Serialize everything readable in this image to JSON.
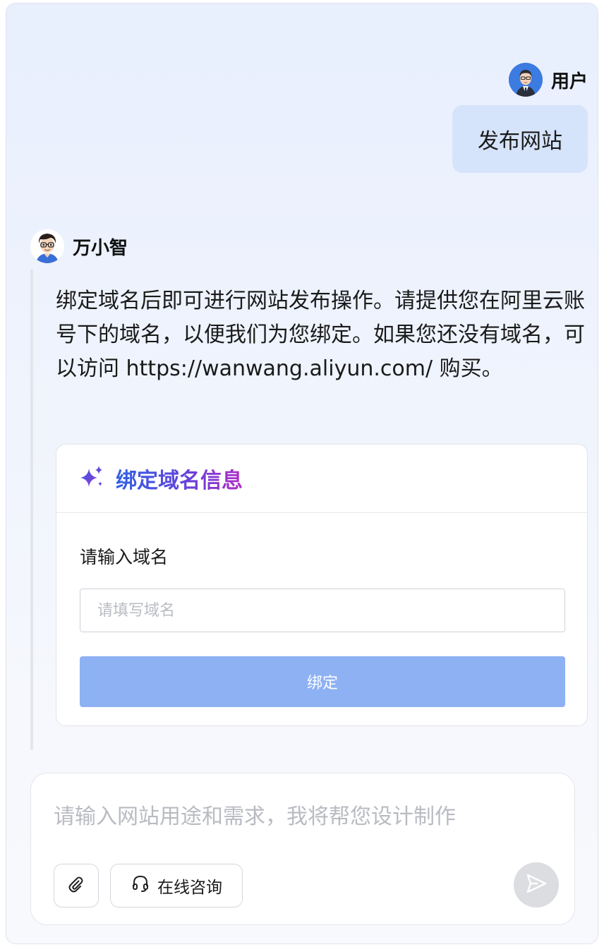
{
  "user": {
    "name": "用户",
    "message": "发布网站"
  },
  "bot": {
    "name": "万小智",
    "message": "绑定域名后即可进行网站发布操作。请提供您在阿里云账号下的域名，以便我们为您绑定。如果您还没有域名，可以访问 https://wanwang.aliyun.com/ 购买。"
  },
  "card": {
    "title": "绑定域名信息",
    "field_label": "请输入域名",
    "field_placeholder": "请填写域名",
    "button_label": "绑定"
  },
  "composer": {
    "placeholder": "请输入网站用途和需求，我将帮您设计制作",
    "consult_label": "在线咨询"
  },
  "colors": {
    "accent": "#8db1f3",
    "user_bubble": "#d6e4fb",
    "title_gradient_start": "#2f61e6",
    "title_gradient_end": "#b02dc8"
  },
  "icons": {
    "user_avatar": "businessman-avatar",
    "bot_avatar": "boy-with-glasses-avatar",
    "card_title": "sparkle-icon",
    "attach": "paperclip-icon",
    "consult": "headset-icon",
    "send": "send-icon"
  }
}
